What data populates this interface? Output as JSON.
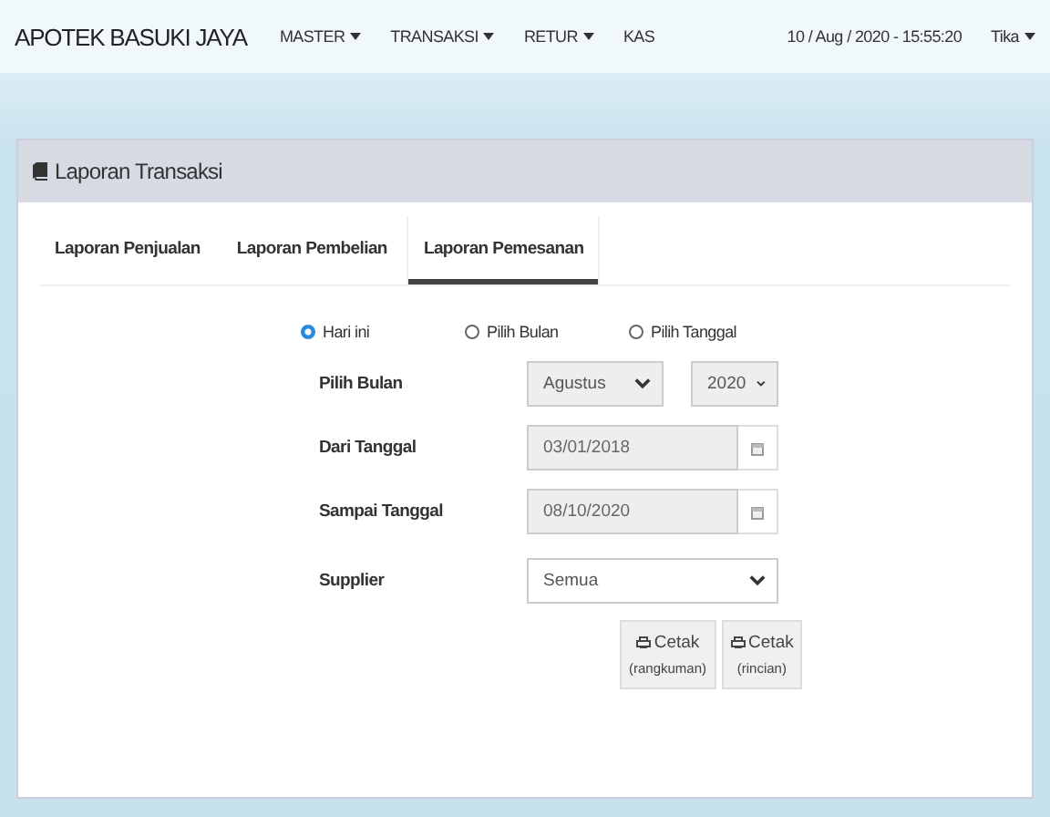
{
  "navbar": {
    "brand": "APOTEK BASUKI JAYA",
    "menus": [
      {
        "label": "MASTER",
        "dropdown": true
      },
      {
        "label": "TRANSAKSI",
        "dropdown": true
      },
      {
        "label": "RETUR",
        "dropdown": true
      },
      {
        "label": "KAS",
        "dropdown": false
      }
    ],
    "datetime": "10 / Aug / 2020 - 15:55:20",
    "user": "Tika"
  },
  "panel": {
    "title": "Laporan Transaksi",
    "tabs": [
      {
        "label": "Laporan Penjualan",
        "selected": false
      },
      {
        "label": "Laporan Pembelian",
        "selected": false
      },
      {
        "label": "Laporan Pemesanan",
        "selected": true
      }
    ],
    "radios": [
      {
        "label": "Hari ini",
        "selected": true
      },
      {
        "label": "Pilih Bulan",
        "selected": false
      },
      {
        "label": "Pilih Tanggal",
        "selected": false
      }
    ],
    "month_row": {
      "label": "Pilih Bulan",
      "month": "Agustus",
      "year": "2020",
      "disabled": true
    },
    "date_rows": [
      {
        "label": "Dari Tanggal",
        "value": "03/01/2018",
        "disabled": true
      },
      {
        "label": "Sampai Tanggal",
        "value": "08/10/2020",
        "disabled": true
      }
    ],
    "supplier": {
      "label": "Supplier",
      "value": "Semua",
      "disabled": false
    },
    "buttons": [
      {
        "label": "Cetak",
        "sub": "(rangkuman)"
      },
      {
        "label": "Cetak",
        "sub": "(rincian)"
      }
    ]
  }
}
